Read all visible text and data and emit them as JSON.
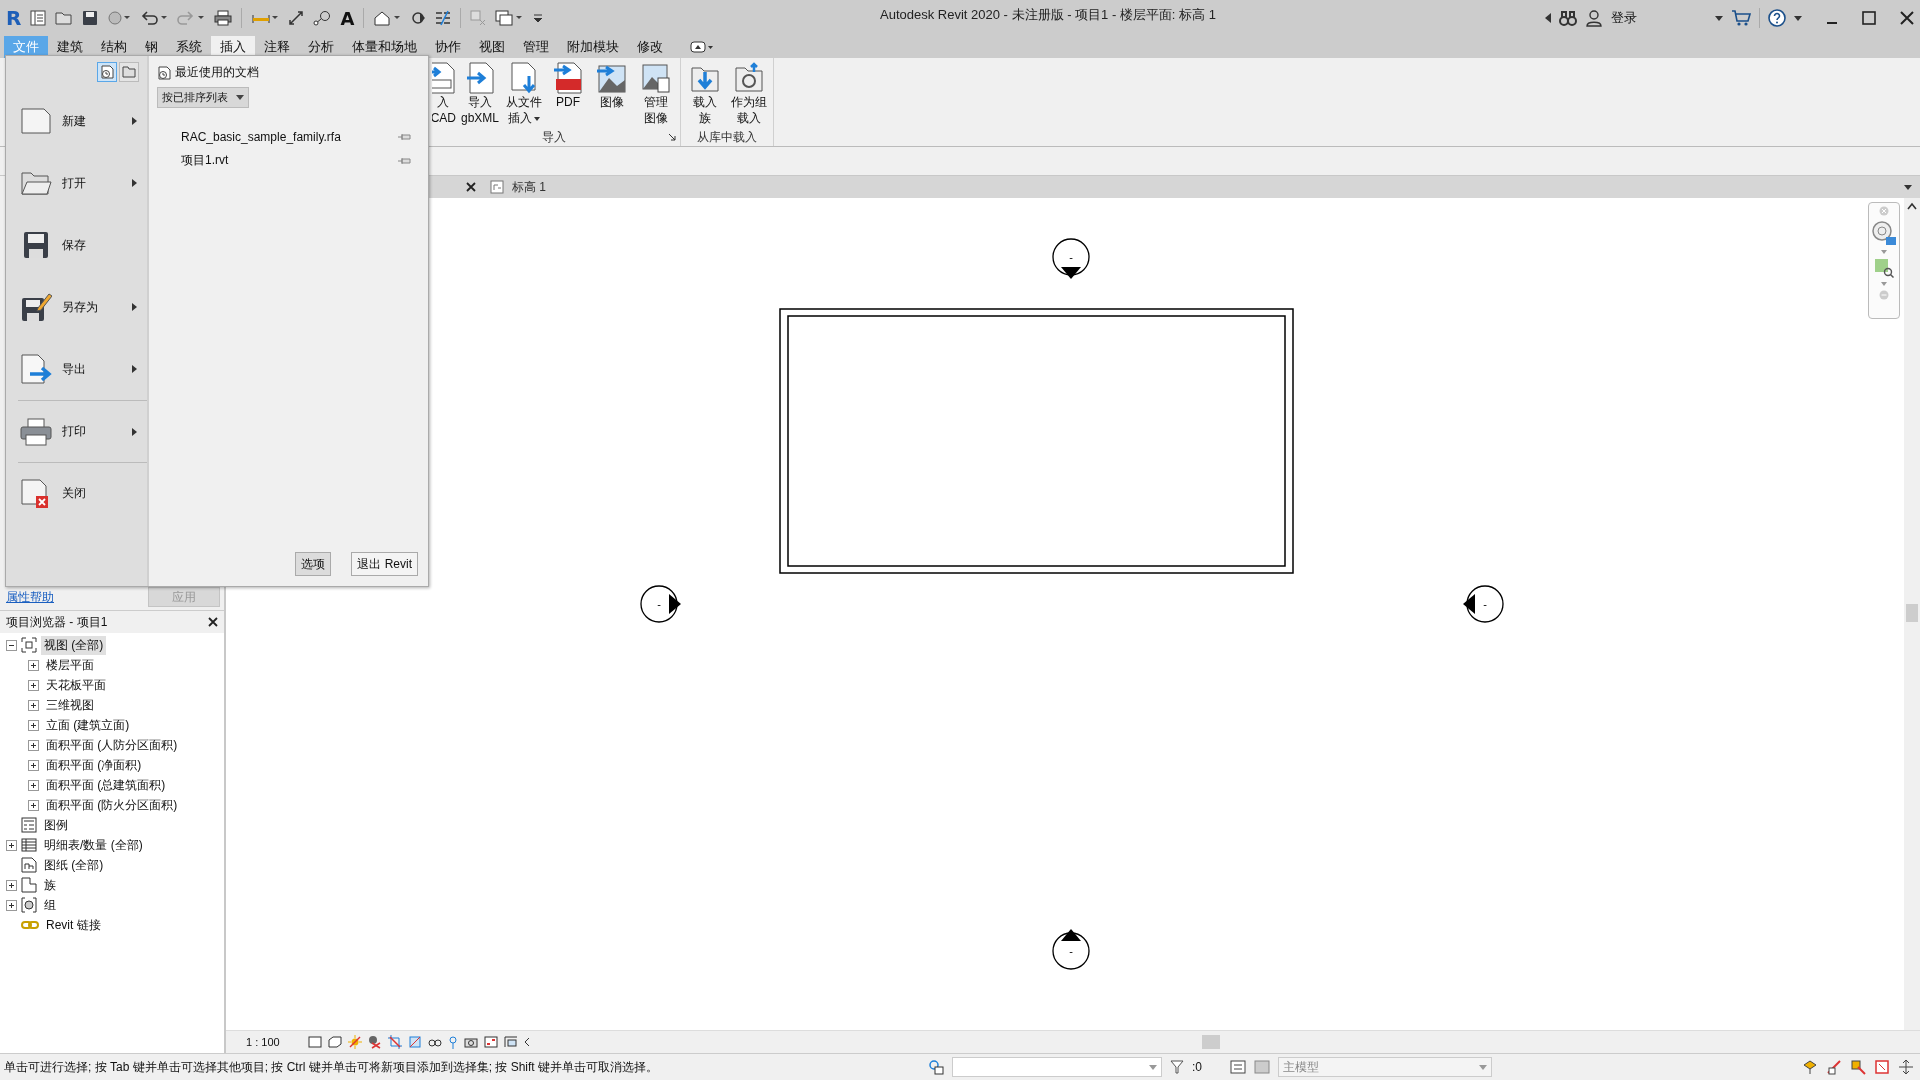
{
  "title_bar": {
    "logo": "R",
    "text_tool": "A",
    "title": "Autodesk Revit 2020 - 未注册版 - 项目1 - 楼层平面: 标高 1",
    "sign_in": "登录"
  },
  "file_tab": {
    "label": "文件",
    "open": true
  },
  "ribbon_tabs": [
    {
      "label": "建筑",
      "selected": false
    },
    {
      "label": "结构",
      "selected": false
    },
    {
      "label": "钢",
      "selected": false
    },
    {
      "label": "系统",
      "selected": false
    },
    {
      "label": "插入",
      "selected": true
    },
    {
      "label": "注释",
      "selected": false
    },
    {
      "label": "分析",
      "selected": false
    },
    {
      "label": "体量和场地",
      "selected": false
    },
    {
      "label": "协作",
      "selected": false
    },
    {
      "label": "视图",
      "selected": false
    },
    {
      "label": "管理",
      "selected": false
    },
    {
      "label": "附加模块",
      "selected": false
    },
    {
      "label": "修改",
      "selected": false
    }
  ],
  "ribbon": {
    "groups": [
      {
        "label": "导入",
        "launcher": true,
        "buttons": [
          {
            "kind": "cad",
            "lines": [
              "入",
              "CAD"
            ],
            "dropdown": false
          },
          {
            "kind": "gbxml",
            "lines": [
              "导入",
              "gbXML"
            ],
            "dropdown": false
          },
          {
            "kind": "insert",
            "lines": [
              "从文件",
              "插入"
            ],
            "dropdown": true
          },
          {
            "kind": "pdf",
            "lines": [
              "PDF"
            ],
            "dropdown": false
          },
          {
            "kind": "image",
            "lines": [
              "图像"
            ],
            "dropdown": false
          },
          {
            "kind": "manage",
            "lines": [
              "管理",
              "图像"
            ],
            "dropdown": false
          }
        ]
      },
      {
        "label": "从库中载入",
        "launcher": false,
        "buttons": [
          {
            "kind": "load",
            "lines": [
              "载入",
              "族"
            ],
            "dropdown": false
          },
          {
            "kind": "group",
            "lines": [
              "作为组",
              "载入"
            ],
            "dropdown": false
          }
        ]
      }
    ]
  },
  "view_tab": {
    "label": "标高 1"
  },
  "file_menu": {
    "view_toggles": [
      {
        "kind": "recent",
        "selected": true
      },
      {
        "kind": "open",
        "selected": false
      }
    ],
    "commands": [
      {
        "kind": "new",
        "label": "新建",
        "submenu": true,
        "separator_before": false
      },
      {
        "kind": "open",
        "label": "打开",
        "submenu": true,
        "separator_before": false
      },
      {
        "kind": "save",
        "label": "保存",
        "submenu": false,
        "separator_before": false
      },
      {
        "kind": "saveas",
        "label": "另存为",
        "submenu": true,
        "separator_before": false
      },
      {
        "kind": "export",
        "label": "导出",
        "submenu": true,
        "separator_before": false
      },
      {
        "kind": "print",
        "label": "打印",
        "submenu": true,
        "separator_before": true
      },
      {
        "kind": "close",
        "label": "关闭",
        "submenu": false,
        "separator_before": true
      }
    ],
    "recent": {
      "title": "最近使用的文档",
      "sort": "按已排序列表",
      "files": [
        {
          "name": "RAC_basic_sample_family.rfa",
          "pinned": false
        },
        {
          "name": "项目1.rvt",
          "pinned": false
        }
      ]
    },
    "buttons": [
      "选项",
      "退出 Revit"
    ]
  },
  "properties": {
    "help_link": "属性帮助",
    "apply_button": {
      "label": "应用",
      "disabled": true
    }
  },
  "project_browser": {
    "title": "项目浏览器 - 项目1",
    "tree": [
      {
        "kind": "views",
        "label": "视图 (全部)",
        "expanded": true,
        "selected": true,
        "children": [
          {
            "label": "楼层平面",
            "expanded": false,
            "selected": false
          },
          {
            "label": "天花板平面",
            "expanded": false,
            "selected": false
          },
          {
            "label": "三维视图",
            "expanded": false,
            "selected": false
          },
          {
            "label": "立面 (建筑立面)",
            "expanded": false,
            "selected": false
          },
          {
            "label": "面积平面 (人防分区面积)",
            "expanded": false,
            "selected": false
          },
          {
            "label": "面积平面 (净面积)",
            "expanded": false,
            "selected": false
          },
          {
            "label": "面积平面 (总建筑面积)",
            "expanded": false,
            "selected": false
          },
          {
            "label": "面积平面 (防火分区面积)",
            "expanded": false,
            "selected": false
          }
        ]
      },
      {
        "kind": "legend",
        "label": "图例",
        "selected": false
      },
      {
        "kind": "schedule",
        "label": "明细表/数量 (全部)",
        "expanded": false,
        "selected": false
      },
      {
        "kind": "sheet",
        "label": "图纸 (全部)",
        "selected": false
      },
      {
        "kind": "family",
        "label": "族",
        "expanded": false,
        "selected": false
      },
      {
        "kind": "group",
        "label": "组",
        "expanded": false,
        "selected": false
      },
      {
        "kind": "link",
        "label": "Revit 链接",
        "selected": false
      }
    ]
  },
  "canvas": {
    "elevation_markers": [
      {
        "kind": "top",
        "label": "-"
      },
      {
        "kind": "left",
        "label": "-"
      },
      {
        "kind": "right",
        "label": "-"
      },
      {
        "kind": "bottom",
        "label": "-"
      }
    ]
  },
  "view_bar": {
    "scale": "1 : 100"
  },
  "status_bar": {
    "message": "单击可进行选择; 按 Tab 键并单击可选择其他项目; 按 Ctrl 键并单击可将新项目添加到选择集; 按 Shift 键并单击可取消选择。",
    "filter_count": ":0",
    "model": "主模型"
  }
}
